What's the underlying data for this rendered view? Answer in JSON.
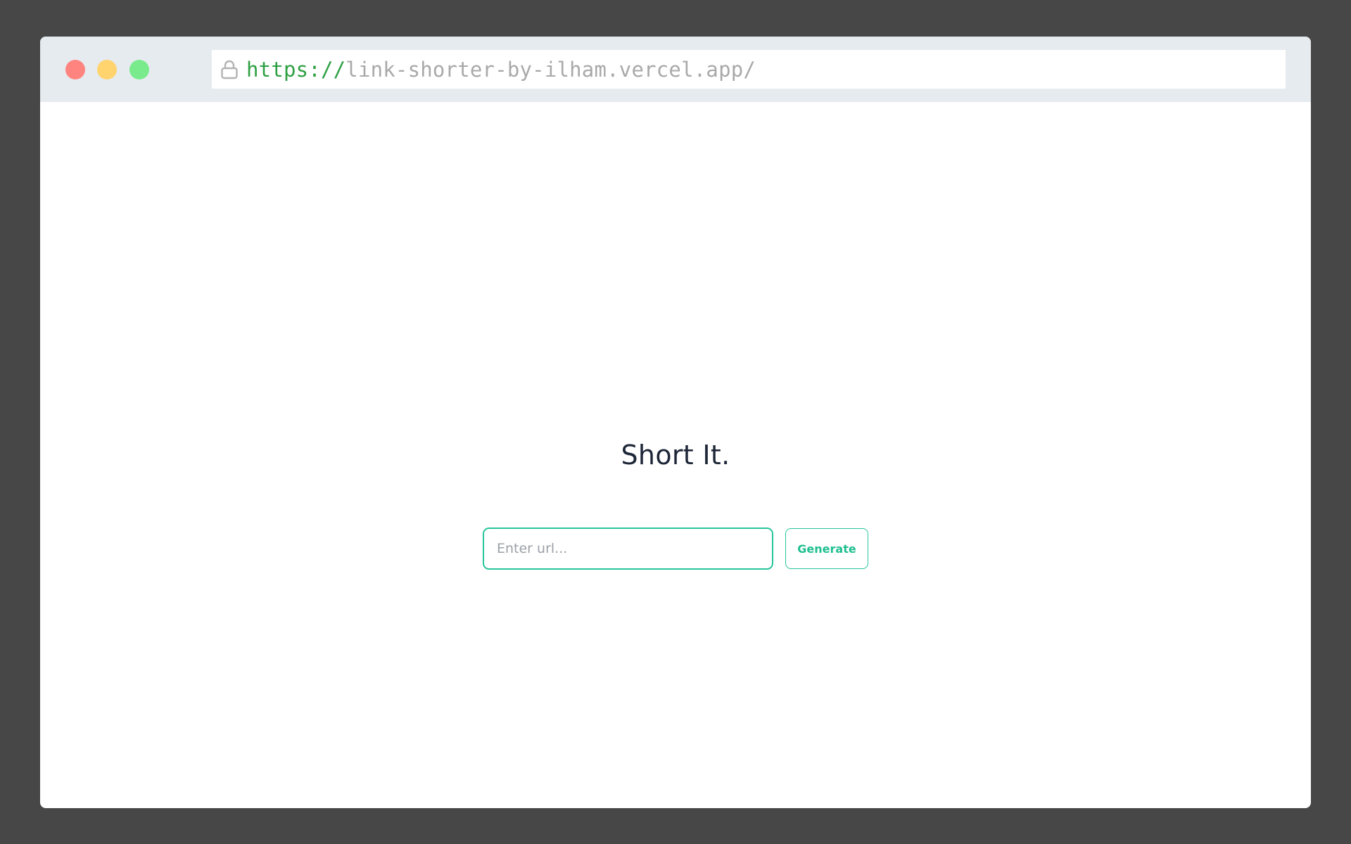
{
  "browser": {
    "url_scheme": "https://",
    "url_host": "link-shorter-by-ilham.vercel.app/",
    "icons": {
      "lock": "lock-icon"
    },
    "colors": {
      "close": "#ff8480",
      "minimize": "#ffd36e",
      "maximize": "#7aeb8c",
      "scheme": "#2ea043"
    }
  },
  "page": {
    "title": "Short It.",
    "input_placeholder": "Enter url...",
    "input_value": "",
    "generate_label": "Generate",
    "accent_color": "#27c59a"
  }
}
